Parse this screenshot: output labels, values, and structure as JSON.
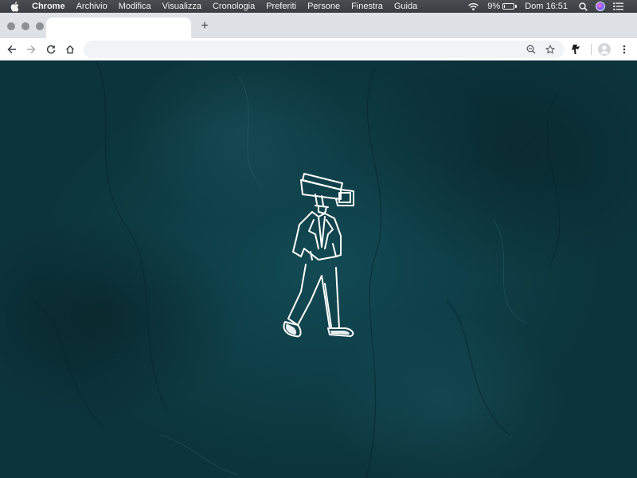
{
  "menubar": {
    "app_name": "Chrome",
    "menus": [
      "Archivio",
      "Modifica",
      "Visualizza",
      "Cronologia",
      "Preferiti",
      "Persone",
      "Finestra",
      "Guida"
    ],
    "battery_percent": "9%",
    "battery_level": 0.09,
    "clock": "Dom 16:51"
  },
  "browser": {
    "tab_title": "",
    "new_tab_label": "+",
    "address_value": "",
    "address_placeholder": ""
  },
  "page": {
    "background_color": "#0f3a42",
    "illustration": "walking-man-with-surveillance-camera-head"
  },
  "colors": {
    "menubar": "#3a3d41",
    "tabstrip": "#dee1e6",
    "toolbar": "#ffffff",
    "line_art": "#ffffff"
  }
}
